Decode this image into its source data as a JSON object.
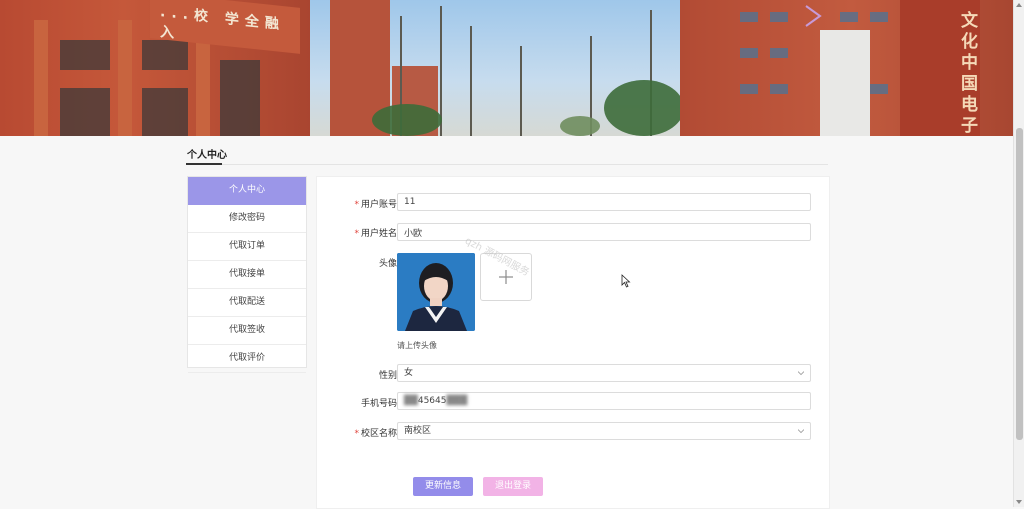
{
  "banner": {
    "left_sign_text": "...校 学全融入",
    "right_sign_text": "文化中国电子"
  },
  "page": {
    "section_title": "个人中心"
  },
  "sidebar": {
    "items": [
      {
        "label": "个人中心",
        "active": true
      },
      {
        "label": "修改密码",
        "active": false
      },
      {
        "label": "代取订单",
        "active": false
      },
      {
        "label": "代取接单",
        "active": false
      },
      {
        "label": "代取配送",
        "active": false
      },
      {
        "label": "代取签收",
        "active": false
      },
      {
        "label": "代取评价",
        "active": false
      }
    ]
  },
  "form": {
    "account": {
      "label": "用户账号",
      "value": "11",
      "required": true
    },
    "name": {
      "label": "用户姓名",
      "value": "小欧",
      "required": true
    },
    "avatar": {
      "label": "头像",
      "hint": "请上传头像",
      "upload_icon": "plus-icon"
    },
    "gender": {
      "label": "性别",
      "value": "女"
    },
    "phone": {
      "label": "手机号码",
      "value_visible": "45645"
    },
    "campus": {
      "label": "校区名称",
      "value": "南校区",
      "required": true
    },
    "update_button": "更新信息",
    "logout_button": "退出登录"
  },
  "watermark": "qzh 源码网服务",
  "colors": {
    "accent": "#9b96e8",
    "update_button": "#938cea",
    "logout_button": "#f2b3e6",
    "required_star": "#e0453d"
  }
}
